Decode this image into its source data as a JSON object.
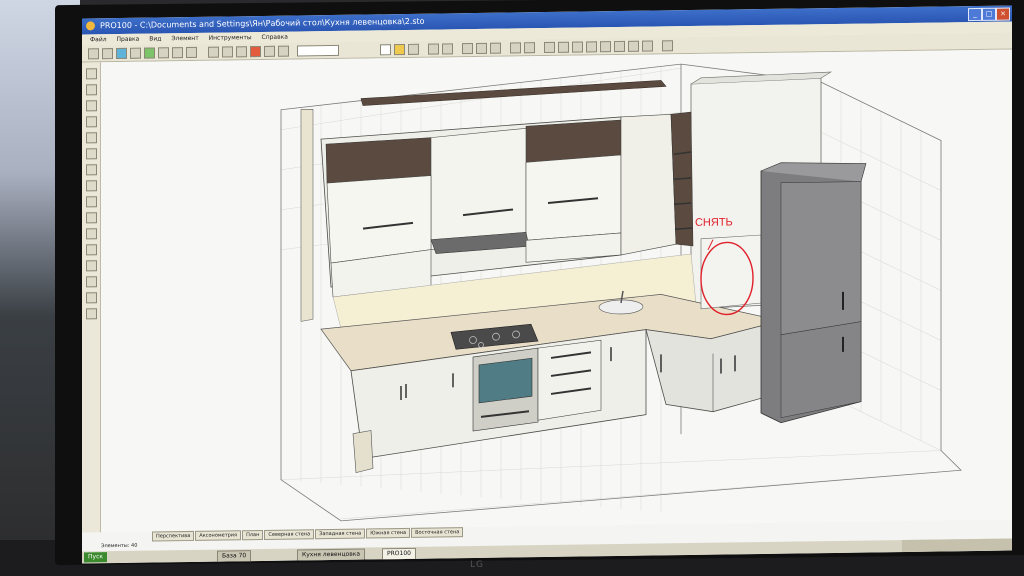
{
  "window": {
    "title": "PRO100 - C:\\Documents and Settings\\Ян\\Рабочий стол\\Кухня левенцовка\\2.sto"
  },
  "menu": {
    "items": [
      "Файл",
      "Правка",
      "Вид",
      "Элемент",
      "Инструменты",
      "Справка"
    ]
  },
  "view_tabs": [
    "Перспектива",
    "Аксонометрия",
    "План",
    "Северная стена",
    "Западная стена",
    "Южная стена",
    "Восточная стена"
  ],
  "status": {
    "elements": "Элементы: 40"
  },
  "taskbar": {
    "start": "Пуск",
    "tasks": [
      "База 70",
      "Кухня левенцовка",
      "PRO100"
    ]
  },
  "annotation": {
    "text": "СНЯТЬ",
    "color": "#e0202a"
  },
  "monitor": {
    "brand": "LG"
  },
  "colors": {
    "titlebar": "#2a56b3",
    "worktop": "#e9dfc8",
    "cabinet": "#efefe9",
    "wood": "#5b4a3f",
    "fridge": "#7d7d80",
    "annotation": "#e0202a"
  }
}
